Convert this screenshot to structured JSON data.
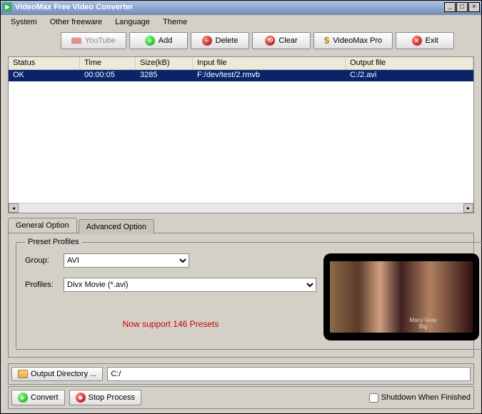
{
  "title": "VideoMax Free Video Converter",
  "menu": [
    "System",
    "Other freeware",
    "Language",
    "Theme"
  ],
  "toolbar": {
    "youtube": "YouTube",
    "add": "Add",
    "delete": "Delete",
    "clear": "Clear",
    "pro": "VideoMax Pro",
    "exit": "Exit"
  },
  "columns": {
    "status": "Status",
    "time": "Time",
    "size": "Size(kB)",
    "input": "Input file",
    "output": "Output file"
  },
  "rows": [
    {
      "status": "OK",
      "time": "00:00:05",
      "size": "3285",
      "input": "F:/dev/test/2.rmvb",
      "output": "C:/2.avi"
    }
  ],
  "tabs": {
    "general": "General Option",
    "advanced": "Advanced Option"
  },
  "preset": {
    "legend": "Preset Profiles",
    "group_label": "Group:",
    "group_value": "AVI",
    "profiles_label": "Profiles:",
    "profiles_value": "Divx Movie (*.avi)",
    "support_text": "Now support 146 Presets"
  },
  "output": {
    "button": "Output Directory ...",
    "path": "C:/"
  },
  "actions": {
    "convert": "Convert",
    "stop": "Stop Process",
    "shutdown": "Shutdown When Finished"
  }
}
